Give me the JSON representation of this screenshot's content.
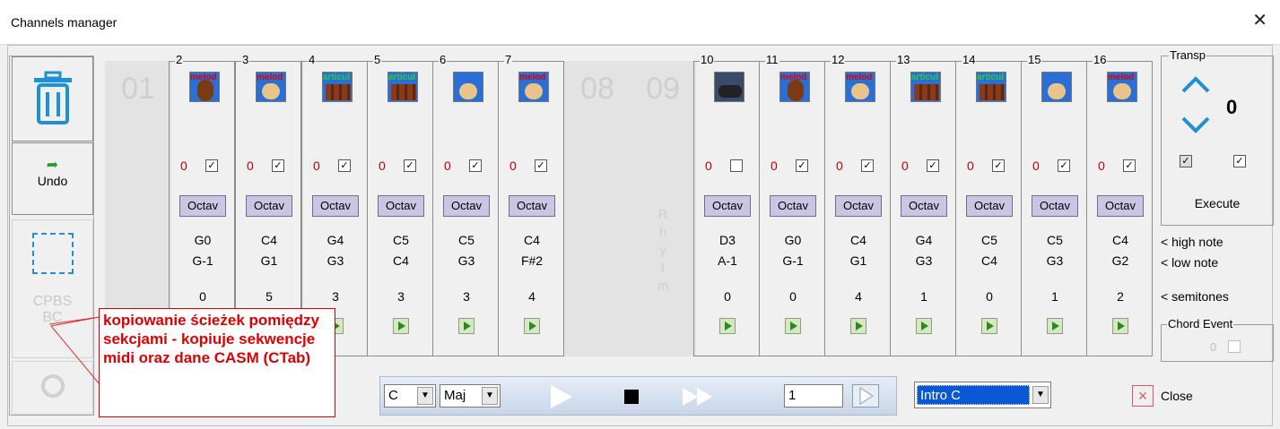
{
  "window": {
    "title": "Channels manager",
    "close_glyph": "✕"
  },
  "left_toolbar": {
    "trash_icon": "trash-icon",
    "undo_label": "Undo",
    "cpbs_label": "CPBS",
    "bc_label": "BC"
  },
  "channels": [
    {
      "num": "2",
      "tag": "melod",
      "zero": "0",
      "checked": true,
      "octav": "Octav",
      "high": "G0",
      "low": "G-1",
      "semi": "0"
    },
    {
      "num": "3",
      "tag": "melod",
      "zero": "0",
      "checked": true,
      "octav": "Octav",
      "high": "C4",
      "low": "G1",
      "semi": "5"
    },
    {
      "num": "4",
      "tag": "articul",
      "zero": "0",
      "checked": true,
      "octav": "Octav",
      "high": "G4",
      "low": "G3",
      "semi": "3"
    },
    {
      "num": "5",
      "tag": "articul",
      "zero": "0",
      "checked": true,
      "octav": "Octav",
      "high": "C5",
      "low": "C4",
      "semi": "3"
    },
    {
      "num": "6",
      "tag": "",
      "zero": "0",
      "checked": true,
      "octav": "Octav",
      "high": "C5",
      "low": "G3",
      "semi": "3"
    },
    {
      "num": "7",
      "tag": "melod",
      "zero": "0",
      "checked": true,
      "octav": "Octav",
      "high": "C4",
      "low": "F#2",
      "semi": "4"
    },
    {
      "num": "10",
      "tag": "",
      "zero": "0",
      "checked": false,
      "octav": "Octav",
      "high": "D3",
      "low": "A-1",
      "semi": "0"
    },
    {
      "num": "11",
      "tag": "melod",
      "zero": "0",
      "checked": true,
      "octav": "Octav",
      "high": "G0",
      "low": "G-1",
      "semi": "0"
    },
    {
      "num": "12",
      "tag": "melod",
      "zero": "0",
      "checked": true,
      "octav": "Octav",
      "high": "C4",
      "low": "G1",
      "semi": "4"
    },
    {
      "num": "13",
      "tag": "articul",
      "zero": "0",
      "checked": true,
      "octav": "Octav",
      "high": "G4",
      "low": "G3",
      "semi": "1"
    },
    {
      "num": "14",
      "tag": "articul",
      "zero": "0",
      "checked": true,
      "octav": "Octav",
      "high": "C5",
      "low": "C4",
      "semi": "0"
    },
    {
      "num": "15",
      "tag": "",
      "zero": "0",
      "checked": true,
      "octav": "Octav",
      "high": "C5",
      "low": "G3",
      "semi": "1"
    },
    {
      "num": "16",
      "tag": "melod",
      "zero": "0",
      "checked": true,
      "octav": "Octav",
      "high": "C4",
      "low": "G2",
      "semi": "2"
    }
  ],
  "empty_channels": {
    "ch01": "01",
    "ch08": "08",
    "ch09": "09",
    "rhythm_letters": [
      "R",
      "h",
      "y",
      "t",
      "m"
    ]
  },
  "transp": {
    "label": "Transp",
    "value": "0",
    "execute": "Execute"
  },
  "legend": {
    "high": "< high note",
    "low": "< low note",
    "semi": "< semitones"
  },
  "chord_event": {
    "label": "Chord Event",
    "value": "0"
  },
  "player": {
    "key": "C",
    "mode": "Maj",
    "bar": "1"
  },
  "section_select": "Intro C",
  "close_label": "Close",
  "note_text": "kopiowanie ścieżek pomiędzy sekcjami - kopiuje sekwencje midi oraz dane CASM (CTab)",
  "colors": {
    "octav_button": "#c9c6e4",
    "icon_bg": "#2a6fd6",
    "note_red": "#d00000",
    "selected": "#0a58d6"
  }
}
